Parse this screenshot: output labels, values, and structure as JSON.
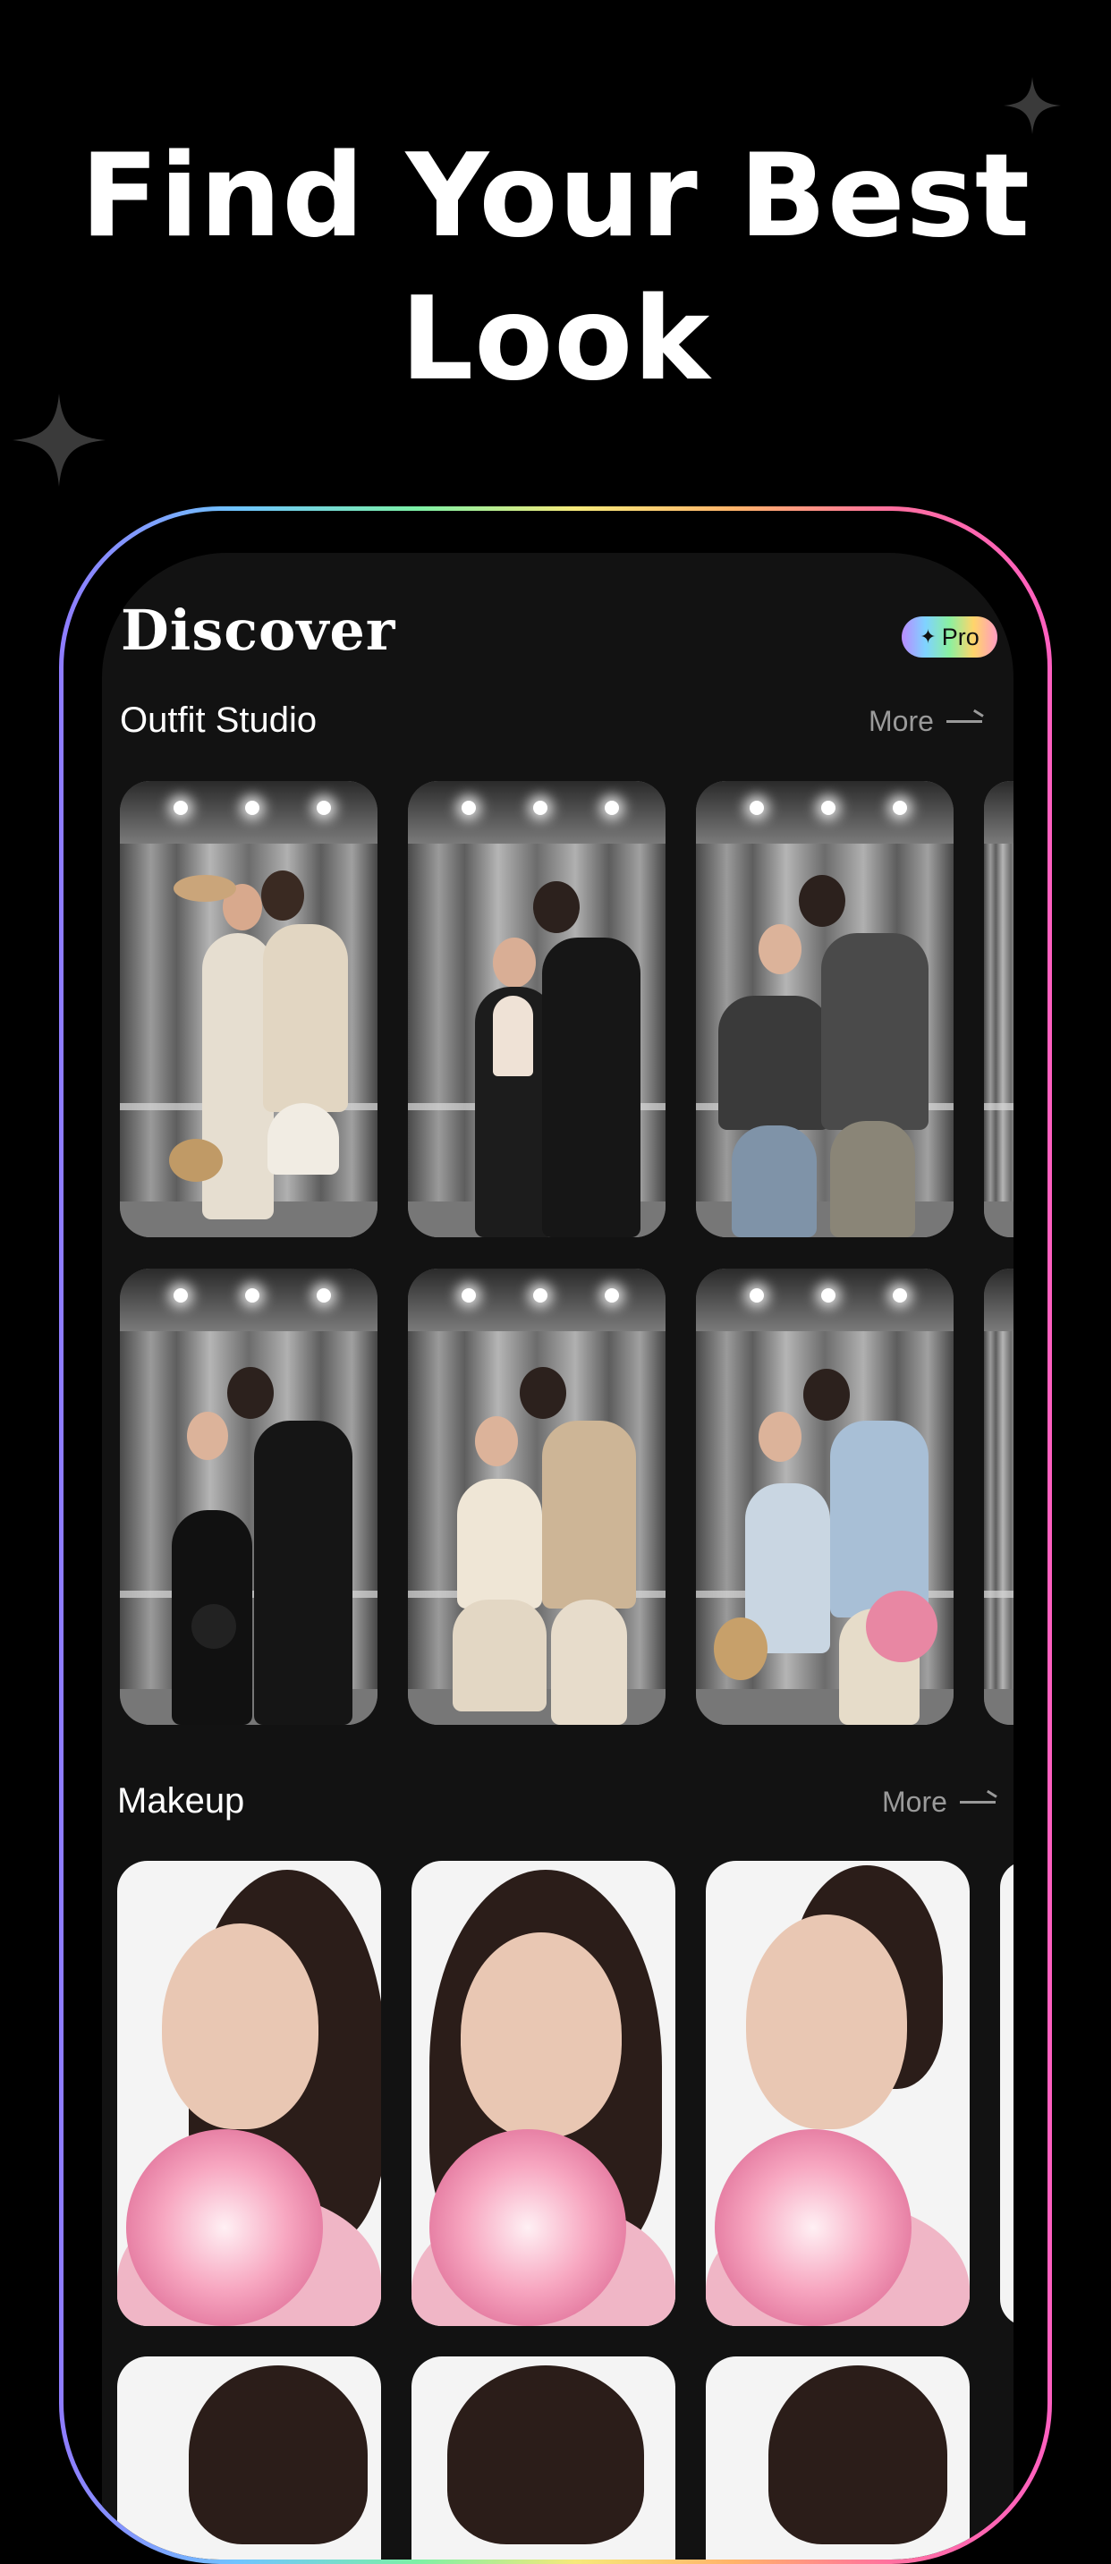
{
  "headline": {
    "line1": "Find Your Best",
    "line2": "Look"
  },
  "app": {
    "title": "Discover",
    "pro_badge": "Pro"
  },
  "outfit": {
    "title": "Outfit Studio",
    "more": "More"
  },
  "makeup": {
    "title": "Makeup",
    "more": "More"
  },
  "icons": [
    "sparkle-icon",
    "pro-star-icon",
    "arrow-right-icon"
  ],
  "colors": {
    "background": "#000000",
    "screen": "#121212",
    "text": "#ffffff",
    "muted": "#9a9a9a"
  }
}
